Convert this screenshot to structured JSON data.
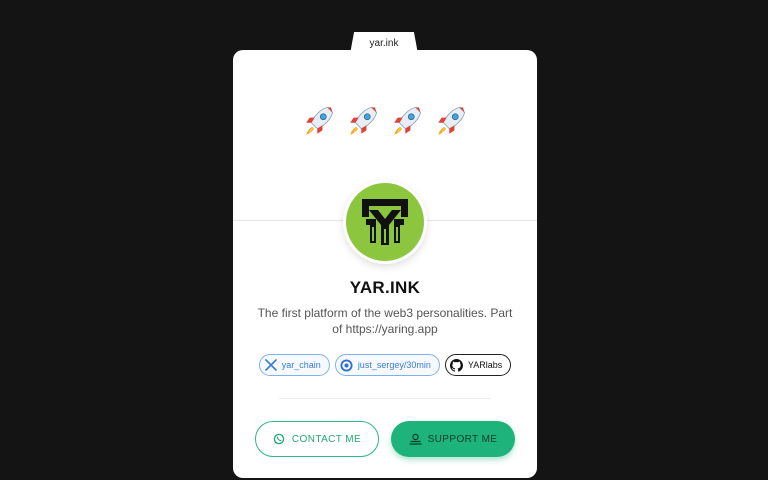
{
  "tab": {
    "label": "yar.ink"
  },
  "rockets": [
    "🚀",
    "🚀",
    "🚀",
    "🚀"
  ],
  "profile": {
    "name": "YAR.INK",
    "bio": "The first platform of the web3 personalities. Part of https://yaring.app"
  },
  "links": [
    {
      "label": "yar_chain",
      "icon": "x-icon"
    },
    {
      "label": "just_sergey/30min",
      "icon": "calendly-icon"
    },
    {
      "label": "YARlabs",
      "icon": "github-icon"
    }
  ],
  "actions": {
    "contact_label": "CONTACT ME",
    "support_label": "SUPPORT ME"
  },
  "colors": {
    "background": "#141414",
    "card": "#ffffff",
    "avatar": "#8cc63f",
    "link_blue": "#3b7bd8",
    "accent_green": "#1db37a"
  }
}
